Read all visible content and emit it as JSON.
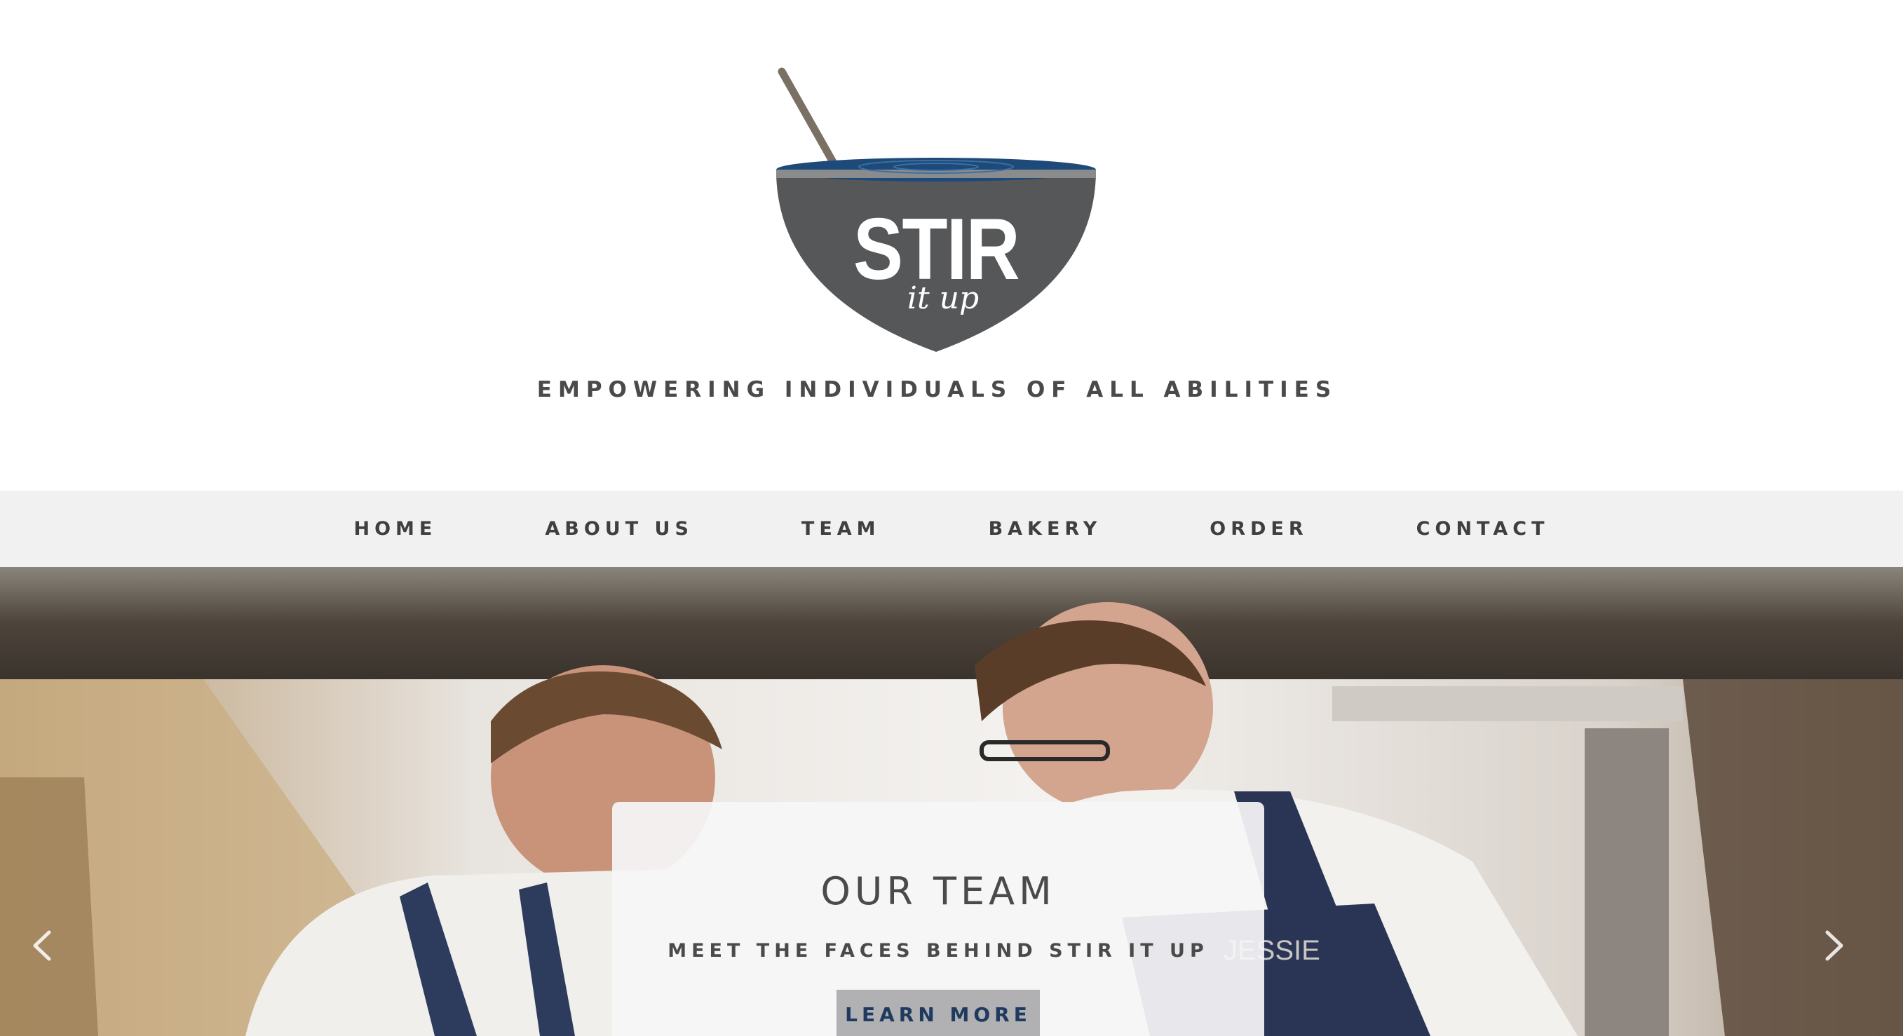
{
  "site": {
    "logo_main": "STIR",
    "logo_script": "it up",
    "tagline": "EMPOWERING INDIVIDUALS OF ALL ABILITIES"
  },
  "nav": {
    "items": [
      {
        "label": "HOME"
      },
      {
        "label": "ABOUT US"
      },
      {
        "label": "TEAM"
      },
      {
        "label": "BAKERY"
      },
      {
        "label": "ORDER"
      },
      {
        "label": "CONTACT"
      }
    ]
  },
  "hero": {
    "title": "OUR TEAM",
    "subtitle": "MEET THE FACES BEHIND STIR IT UP",
    "cta_label": "LEARN MORE",
    "apron_name": "JESSIE"
  },
  "icons": {
    "logo": "mixing-bowl-icon",
    "prev": "chevron-left-icon",
    "next": "chevron-right-icon"
  },
  "colors": {
    "bowl": "#565758",
    "bowl_rim": "#1d4a78",
    "nav_bg": "#f1f1f1",
    "cta_bg": "#b1b1b3",
    "cta_text": "#1f3a5f"
  }
}
